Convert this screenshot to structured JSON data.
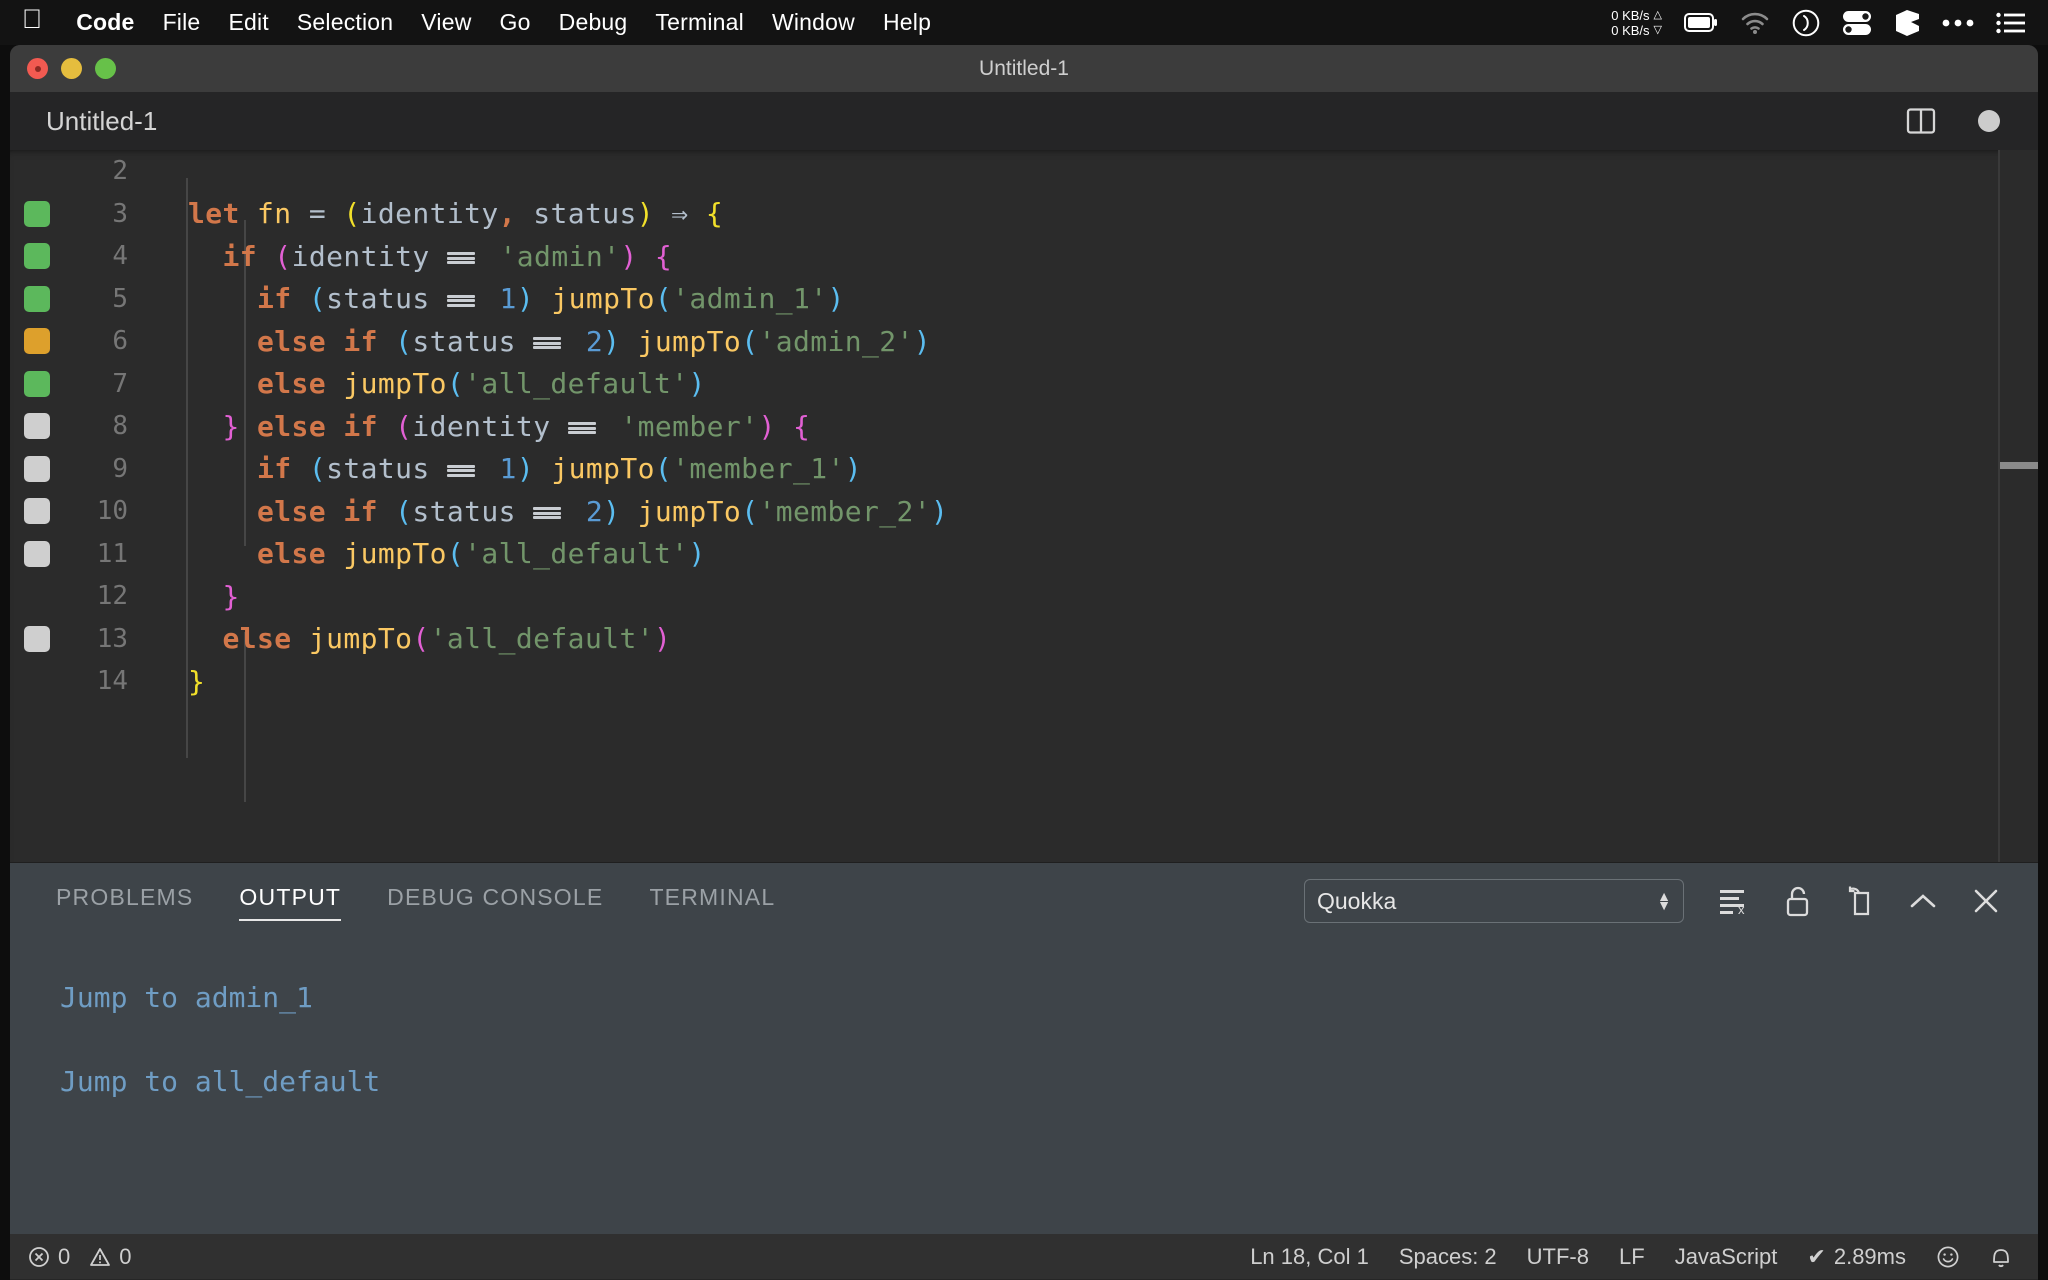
{
  "menubar": {
    "apple": "",
    "items": [
      {
        "label": "Code",
        "bold": true
      },
      {
        "label": "File",
        "bold": false
      },
      {
        "label": "Edit",
        "bold": false
      },
      {
        "label": "Selection",
        "bold": false
      },
      {
        "label": "View",
        "bold": false
      },
      {
        "label": "Go",
        "bold": false
      },
      {
        "label": "Debug",
        "bold": false
      },
      {
        "label": "Terminal",
        "bold": false
      },
      {
        "label": "Window",
        "bold": false
      },
      {
        "label": "Help",
        "bold": false
      }
    ],
    "netspeed_up": "0 KB/s",
    "netspeed_down": "0 KB/s",
    "status_icons": [
      "network-speed-icon",
      "battery-icon",
      "wifi-icon",
      "clock-icon",
      "toggles-icon",
      "cube-icon",
      "ellipsis-icon",
      "list-icon"
    ]
  },
  "window": {
    "title": "Untitled-1",
    "traffic_lights": [
      "close",
      "minimize",
      "zoom"
    ]
  },
  "editor_tab": {
    "label": "Untitled-1",
    "split_icon": "split-editor-icon",
    "dirty_indicator": "unsaved-dot"
  },
  "editor": {
    "language": "JavaScript",
    "first_visible_line": 2,
    "lines": [
      {
        "num": "2",
        "mark": null,
        "indent": 0,
        "tokens": []
      },
      {
        "num": "3",
        "mark": "green",
        "indent": 0,
        "tokens": [
          {
            "t": "let",
            "c": "t-let"
          },
          {
            "t": " ",
            "c": "t-var"
          },
          {
            "t": "fn",
            "c": "t-fnname"
          },
          {
            "t": " ",
            "c": "t-var"
          },
          {
            "t": "=",
            "c": "t-op"
          },
          {
            "t": " ",
            "c": "t-var"
          },
          {
            "t": "(",
            "c": "b-yellow"
          },
          {
            "t": "identity",
            "c": "t-var"
          },
          {
            "t": ",",
            "c": "t-kw"
          },
          {
            "t": " status",
            "c": "t-var"
          },
          {
            "t": ")",
            "c": "b-yellow"
          },
          {
            "t": " ",
            "c": "t-var"
          },
          {
            "t": "⇒",
            "c": "t-arrow"
          },
          {
            "t": " ",
            "c": "t-var"
          },
          {
            "t": "{",
            "c": "b-yellow"
          }
        ]
      },
      {
        "num": "4",
        "mark": "green",
        "indent": 1,
        "tokens": [
          {
            "t": "  ",
            "c": "t-var"
          },
          {
            "t": "if",
            "c": "t-kw"
          },
          {
            "t": " ",
            "c": "t-var"
          },
          {
            "t": "(",
            "c": "b-pink"
          },
          {
            "t": "identity ",
            "c": "t-var"
          },
          {
            "t": "===",
            "c": "eq"
          },
          {
            "t": " ",
            "c": "t-var"
          },
          {
            "t": "'admin'",
            "c": "t-str"
          },
          {
            "t": ")",
            "c": "b-pink"
          },
          {
            "t": " ",
            "c": "t-var"
          },
          {
            "t": "{",
            "c": "b-pink"
          }
        ]
      },
      {
        "num": "5",
        "mark": "green",
        "indent": 2,
        "tokens": [
          {
            "t": "    ",
            "c": "t-var"
          },
          {
            "t": "if",
            "c": "t-kw"
          },
          {
            "t": " ",
            "c": "t-var"
          },
          {
            "t": "(",
            "c": "b-blue"
          },
          {
            "t": "status ",
            "c": "t-var"
          },
          {
            "t": "===",
            "c": "eq"
          },
          {
            "t": " ",
            "c": "t-var"
          },
          {
            "t": "1",
            "c": "t-num"
          },
          {
            "t": ")",
            "c": "b-blue"
          },
          {
            "t": " ",
            "c": "t-var"
          },
          {
            "t": "jumpTo",
            "c": "t-fnname"
          },
          {
            "t": "(",
            "c": "b-blue"
          },
          {
            "t": "'admin_1'",
            "c": "t-str"
          },
          {
            "t": ")",
            "c": "b-blue"
          }
        ]
      },
      {
        "num": "6",
        "mark": "orange",
        "indent": 2,
        "tokens": [
          {
            "t": "    ",
            "c": "t-var"
          },
          {
            "t": "else",
            "c": "t-kw"
          },
          {
            "t": " ",
            "c": "t-var"
          },
          {
            "t": "if",
            "c": "t-kw"
          },
          {
            "t": " ",
            "c": "t-var"
          },
          {
            "t": "(",
            "c": "b-blue"
          },
          {
            "t": "status ",
            "c": "t-var"
          },
          {
            "t": "===",
            "c": "eq"
          },
          {
            "t": " ",
            "c": "t-var"
          },
          {
            "t": "2",
            "c": "t-num"
          },
          {
            "t": ")",
            "c": "b-blue"
          },
          {
            "t": " ",
            "c": "t-var"
          },
          {
            "t": "jumpTo",
            "c": "t-fnname"
          },
          {
            "t": "(",
            "c": "b-blue"
          },
          {
            "t": "'admin_2'",
            "c": "t-str"
          },
          {
            "t": ")",
            "c": "b-blue"
          }
        ]
      },
      {
        "num": "7",
        "mark": "green",
        "indent": 2,
        "tokens": [
          {
            "t": "    ",
            "c": "t-var"
          },
          {
            "t": "else",
            "c": "t-kw"
          },
          {
            "t": " ",
            "c": "t-var"
          },
          {
            "t": "jumpTo",
            "c": "t-fnname"
          },
          {
            "t": "(",
            "c": "b-blue"
          },
          {
            "t": "'all_default'",
            "c": "t-str"
          },
          {
            "t": ")",
            "c": "b-blue"
          }
        ]
      },
      {
        "num": "8",
        "mark": "gray",
        "indent": 1,
        "tokens": [
          {
            "t": "  ",
            "c": "t-var"
          },
          {
            "t": "}",
            "c": "b-pink"
          },
          {
            "t": " ",
            "c": "t-var"
          },
          {
            "t": "else",
            "c": "t-kw"
          },
          {
            "t": " ",
            "c": "t-var"
          },
          {
            "t": "if",
            "c": "t-kw"
          },
          {
            "t": " ",
            "c": "t-var"
          },
          {
            "t": "(",
            "c": "b-pink"
          },
          {
            "t": "identity ",
            "c": "t-var"
          },
          {
            "t": "===",
            "c": "eq"
          },
          {
            "t": " ",
            "c": "t-var"
          },
          {
            "t": "'member'",
            "c": "t-str"
          },
          {
            "t": ")",
            "c": "b-pink"
          },
          {
            "t": " ",
            "c": "t-var"
          },
          {
            "t": "{",
            "c": "b-pink"
          }
        ]
      },
      {
        "num": "9",
        "mark": "gray",
        "indent": 2,
        "tokens": [
          {
            "t": "    ",
            "c": "t-var"
          },
          {
            "t": "if",
            "c": "t-kw"
          },
          {
            "t": " ",
            "c": "t-var"
          },
          {
            "t": "(",
            "c": "b-blue"
          },
          {
            "t": "status ",
            "c": "t-var"
          },
          {
            "t": "===",
            "c": "eq"
          },
          {
            "t": " ",
            "c": "t-var"
          },
          {
            "t": "1",
            "c": "t-num"
          },
          {
            "t": ")",
            "c": "b-blue"
          },
          {
            "t": " ",
            "c": "t-var"
          },
          {
            "t": "jumpTo",
            "c": "t-fnname"
          },
          {
            "t": "(",
            "c": "b-blue"
          },
          {
            "t": "'member_1'",
            "c": "t-str"
          },
          {
            "t": ")",
            "c": "b-blue"
          }
        ]
      },
      {
        "num": "10",
        "mark": "gray",
        "indent": 2,
        "tokens": [
          {
            "t": "    ",
            "c": "t-var"
          },
          {
            "t": "else",
            "c": "t-kw"
          },
          {
            "t": " ",
            "c": "t-var"
          },
          {
            "t": "if",
            "c": "t-kw"
          },
          {
            "t": " ",
            "c": "t-var"
          },
          {
            "t": "(",
            "c": "b-blue"
          },
          {
            "t": "status ",
            "c": "t-var"
          },
          {
            "t": "===",
            "c": "eq"
          },
          {
            "t": " ",
            "c": "t-var"
          },
          {
            "t": "2",
            "c": "t-num"
          },
          {
            "t": ")",
            "c": "b-blue"
          },
          {
            "t": " ",
            "c": "t-var"
          },
          {
            "t": "jumpTo",
            "c": "t-fnname"
          },
          {
            "t": "(",
            "c": "b-blue"
          },
          {
            "t": "'member_2'",
            "c": "t-str"
          },
          {
            "t": ")",
            "c": "b-blue"
          }
        ]
      },
      {
        "num": "11",
        "mark": "gray",
        "indent": 2,
        "tokens": [
          {
            "t": "    ",
            "c": "t-var"
          },
          {
            "t": "else",
            "c": "t-kw"
          },
          {
            "t": " ",
            "c": "t-var"
          },
          {
            "t": "jumpTo",
            "c": "t-fnname"
          },
          {
            "t": "(",
            "c": "b-blue"
          },
          {
            "t": "'all_default'",
            "c": "t-str"
          },
          {
            "t": ")",
            "c": "b-blue"
          }
        ]
      },
      {
        "num": "12",
        "mark": null,
        "indent": 1,
        "tokens": [
          {
            "t": "  ",
            "c": "t-var"
          },
          {
            "t": "}",
            "c": "b-pink"
          }
        ]
      },
      {
        "num": "13",
        "mark": "gray",
        "indent": 1,
        "tokens": [
          {
            "t": "  ",
            "c": "t-var"
          },
          {
            "t": "else",
            "c": "t-kw"
          },
          {
            "t": " ",
            "c": "t-var"
          },
          {
            "t": "jumpTo",
            "c": "t-fnname"
          },
          {
            "t": "(",
            "c": "b-pink"
          },
          {
            "t": "'all_default'",
            "c": "t-str"
          },
          {
            "t": ")",
            "c": "b-pink"
          }
        ]
      },
      {
        "num": "14",
        "mark": null,
        "indent": 0,
        "tokens": [
          {
            "t": "}",
            "c": "b-yellow"
          }
        ]
      }
    ]
  },
  "panel": {
    "tabs": [
      {
        "label": "PROBLEMS",
        "active": false
      },
      {
        "label": "OUTPUT",
        "active": true
      },
      {
        "label": "DEBUG CONSOLE",
        "active": false
      },
      {
        "label": "TERMINAL",
        "active": false
      }
    ],
    "channel_select": "Quokka",
    "actions": [
      "clear-output-icon",
      "lock-scroll-icon",
      "open-in-editor-icon",
      "maximize-panel-icon",
      "close-panel-icon"
    ],
    "output_lines": [
      "Jump to admin_1",
      "Jump to all_default"
    ]
  },
  "statusbar": {
    "errors": "0",
    "warnings": "0",
    "cursor": "Ln 18, Col 1",
    "indent": "Spaces: 2",
    "encoding": "UTF-8",
    "eol": "LF",
    "language": "JavaScript",
    "runtime": "2.89ms",
    "runtime_check": "✔",
    "feedback_icon": "smiley-icon",
    "bell_icon": "bell-icon"
  },
  "colors": {
    "marker_green": "#5cb85c",
    "marker_orange": "#dda02c",
    "marker_gray": "#cfcfcf",
    "accent_yellow": "#f2e02a",
    "accent_pink": "#e260d4",
    "accent_blue": "#5bbdf0",
    "output_text": "#6f9dc4"
  }
}
